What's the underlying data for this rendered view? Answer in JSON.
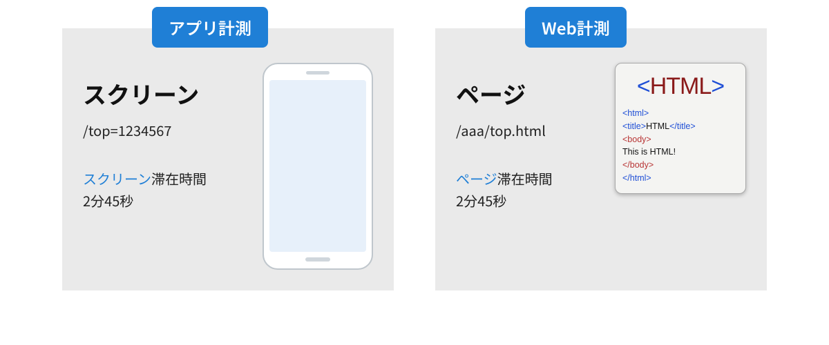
{
  "app": {
    "badge": "アプリ計測",
    "title": "スクリーン",
    "path": "/top=1234567",
    "stay_prefix": "スクリーン",
    "stay_suffix": "滞在時間",
    "duration": "2分45秒"
  },
  "web": {
    "badge": "Web計測",
    "title": "ページ",
    "path": "/aaa/top.html",
    "stay_prefix": "ページ",
    "stay_suffix": "滞在時間",
    "duration": "2分45秒",
    "doc": {
      "big_open": "<",
      "big_text": "HTML",
      "big_close": ">",
      "line1": "<html>",
      "line2a": "<title>",
      "line2b": "HTML",
      "line2c": "</title>",
      "line3": "<body>",
      "line4": "This is HTML!",
      "line5": "</body>",
      "line6": "</html>"
    }
  }
}
